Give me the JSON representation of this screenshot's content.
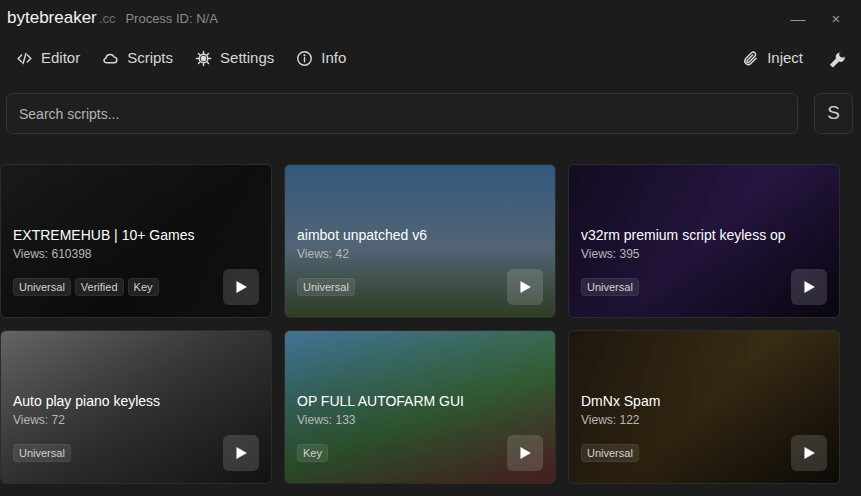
{
  "window": {
    "title": "bytebreaker",
    "suffix": ".cc",
    "process": "Process ID: N/A",
    "controls": [
      "—",
      "×"
    ]
  },
  "nav": {
    "items": [
      {
        "label": "Editor"
      },
      {
        "label": "Scripts"
      },
      {
        "label": "Settings"
      },
      {
        "label": "Info"
      }
    ],
    "action": "Inject"
  },
  "search": {
    "placeholder": "Search scripts...",
    "button": "S"
  },
  "scripts": [
    {
      "title": "EXTREMEHUB | 10+ Games",
      "views": "Views: 610398",
      "tags": [
        "Universal",
        "Verified",
        "Key"
      ]
    },
    {
      "title": "aimbot unpatched v6",
      "views": "Views: 42",
      "tags": [
        "Universal"
      ]
    },
    {
      "title": "v32rm premium script keyless op",
      "views": "Views: 395",
      "tags": [
        "Universal"
      ]
    },
    {
      "title": "Auto play piano keyless",
      "views": "Views: 72",
      "tags": [
        "Universal"
      ]
    },
    {
      "title": "OP FULL AUTOFARM GUI",
      "views": "Views: 133",
      "tags": [
        "Key"
      ]
    },
    {
      "title": "DmNx Spam",
      "views": "Views: 122",
      "tags": [
        "Universal"
      ]
    }
  ]
}
